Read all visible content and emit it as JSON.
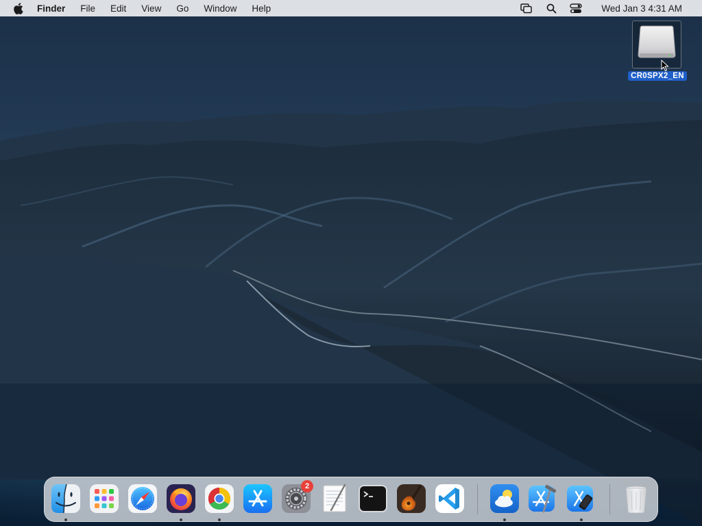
{
  "menubar": {
    "app_name": "Finder",
    "items": [
      "File",
      "Edit",
      "View",
      "Go",
      "Window",
      "Help"
    ],
    "clock": "Wed Jan 3  4:31 AM",
    "status_icons": [
      "screen-mirroring-icon",
      "spotlight-search-icon",
      "control-center-icon"
    ]
  },
  "desktop": {
    "drive_label": "CR0SPX2_EN",
    "drive_icon": "external-drive-icon"
  },
  "dock": {
    "apps": [
      {
        "name": "Finder",
        "icon": "finder-icon",
        "running": true
      },
      {
        "name": "Launchpad",
        "icon": "launchpad-icon",
        "running": false
      },
      {
        "name": "Safari",
        "icon": "safari-icon",
        "running": false
      },
      {
        "name": "Firefox",
        "icon": "firefox-icon",
        "running": true
      },
      {
        "name": "Google Chrome",
        "icon": "chrome-icon",
        "running": true
      },
      {
        "name": "App Store",
        "icon": "app-store-icon",
        "running": false
      },
      {
        "name": "System Preferences",
        "icon": "system-preferences-icon",
        "running": false,
        "badge": "2"
      },
      {
        "name": "TextEdit",
        "icon": "textedit-icon",
        "running": false
      },
      {
        "name": "Terminal",
        "icon": "terminal-icon",
        "running": false
      },
      {
        "name": "GarageBand",
        "icon": "garageband-icon",
        "running": false
      },
      {
        "name": "Visual Studio Code",
        "icon": "vscode-icon",
        "running": false
      },
      {
        "name": "Weather",
        "icon": "weather-icon",
        "running": true
      },
      {
        "name": "Xcode",
        "icon": "xcode-icon",
        "running": false
      },
      {
        "name": "Simulator",
        "icon": "simulator-icon",
        "running": true
      },
      {
        "name": "Trash",
        "icon": "trash-icon",
        "running": false
      }
    ]
  },
  "colors": {
    "menubar_bg": "#e4e6ea",
    "selection_blue": "#1f5fc8",
    "badge_red": "#e8413a"
  }
}
